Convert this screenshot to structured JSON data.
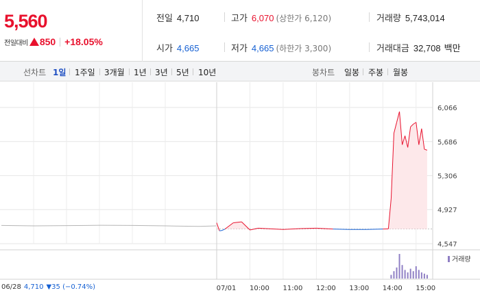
{
  "quote": {
    "price": "5,560",
    "change_label": "전일대비",
    "change_amount": "850",
    "change_pct": "+18.05%"
  },
  "stats": {
    "prev_close": {
      "label": "전일",
      "value": "4,710"
    },
    "high": {
      "label": "고가",
      "value": "6,070",
      "sub": "(상한가 6,120)"
    },
    "volume": {
      "label": "거래량",
      "value": "5,743,014"
    },
    "open": {
      "label": "시가",
      "value": "4,665"
    },
    "low": {
      "label": "저가",
      "value": "4,665",
      "sub": "(하한가 3,300)"
    },
    "trade_value": {
      "label": "거래대금",
      "value": "32,708",
      "unit": "백만"
    }
  },
  "tabs": {
    "line_header": "선차트",
    "line_items": [
      "1일",
      "1주일",
      "3개월",
      "1년",
      "3년",
      "5년",
      "10년"
    ],
    "active_line": "1일",
    "candle_header": "봉차트",
    "candle_items": [
      "일봉",
      "주봉",
      "월봉"
    ]
  },
  "colors": {
    "up": "#e8112d",
    "down": "#1560d3",
    "prev_day_line": "#b5b5b5",
    "volume_bar": "#8f7fc4",
    "area_fill": "#fde8ea"
  },
  "footer": {
    "prev_date": "06/28",
    "prev_close": "4,710",
    "prev_change": "▼35 (−0.74%)",
    "volume_legend": "거래량"
  },
  "chart_data": {
    "type": "line",
    "title": "",
    "xlabel": "",
    "ylabel": "",
    "y_ticks": [
      "6,066",
      "5,686",
      "5,306",
      "4,927",
      "4,547"
    ],
    "y_tick_values": [
      6066,
      5686,
      5306,
      4927,
      4547
    ],
    "ylim": [
      4547,
      6066
    ],
    "x_ticks": [
      "06/28",
      "07/01",
      "10:00",
      "11:00",
      "12:00",
      "13:00",
      "14:00",
      "15:00"
    ],
    "reference_line": 4710,
    "grid": true,
    "series": [
      {
        "x": [
          "06/28 09:00",
          "06/28 10:00",
          "06/28 11:00",
          "06/28 12:00",
          "06/28 13:00",
          "06/28 14:00",
          "06/28 15:00",
          "06/28 15:30"
        ],
        "y": [
          4750,
          4745,
          4748,
          4752,
          4750,
          4745,
          4740,
          4745
        ]
      },
      {
        "x": [
          "09:00",
          "09:05",
          "09:10",
          "09:15",
          "09:30",
          "09:45",
          "10:00",
          "10:15",
          "10:30",
          "11:00",
          "11:30",
          "12:00",
          "12:30",
          "13:00",
          "13:30",
          "14:00",
          "14:10",
          "14:15",
          "14:20",
          "14:25",
          "14:30",
          "14:35",
          "14:40",
          "14:45",
          "14:50",
          "14:55",
          "15:00",
          "15:05",
          "15:10",
          "15:15",
          "15:20"
        ],
        "y": [
          4780,
          4690,
          4695,
          4710,
          4780,
          4790,
          4700,
          4720,
          4715,
          4705,
          4715,
          4720,
          4710,
          4705,
          4705,
          4710,
          4712,
          5050,
          5780,
          5900,
          6020,
          5650,
          5750,
          5620,
          5850,
          5880,
          5900,
          5650,
          5830,
          5600,
          5590
        ]
      }
    ],
    "volume": {
      "x": [
        "14:15",
        "14:20",
        "14:25",
        "14:30",
        "14:35",
        "14:40",
        "14:45",
        "14:50",
        "14:55",
        "15:00",
        "15:05",
        "15:10",
        "15:15",
        "15:20"
      ],
      "relative": [
        0.15,
        0.3,
        0.45,
        1.0,
        0.55,
        0.35,
        0.25,
        0.4,
        0.3,
        0.5,
        0.35,
        0.25,
        0.2,
        0.15
      ]
    }
  }
}
